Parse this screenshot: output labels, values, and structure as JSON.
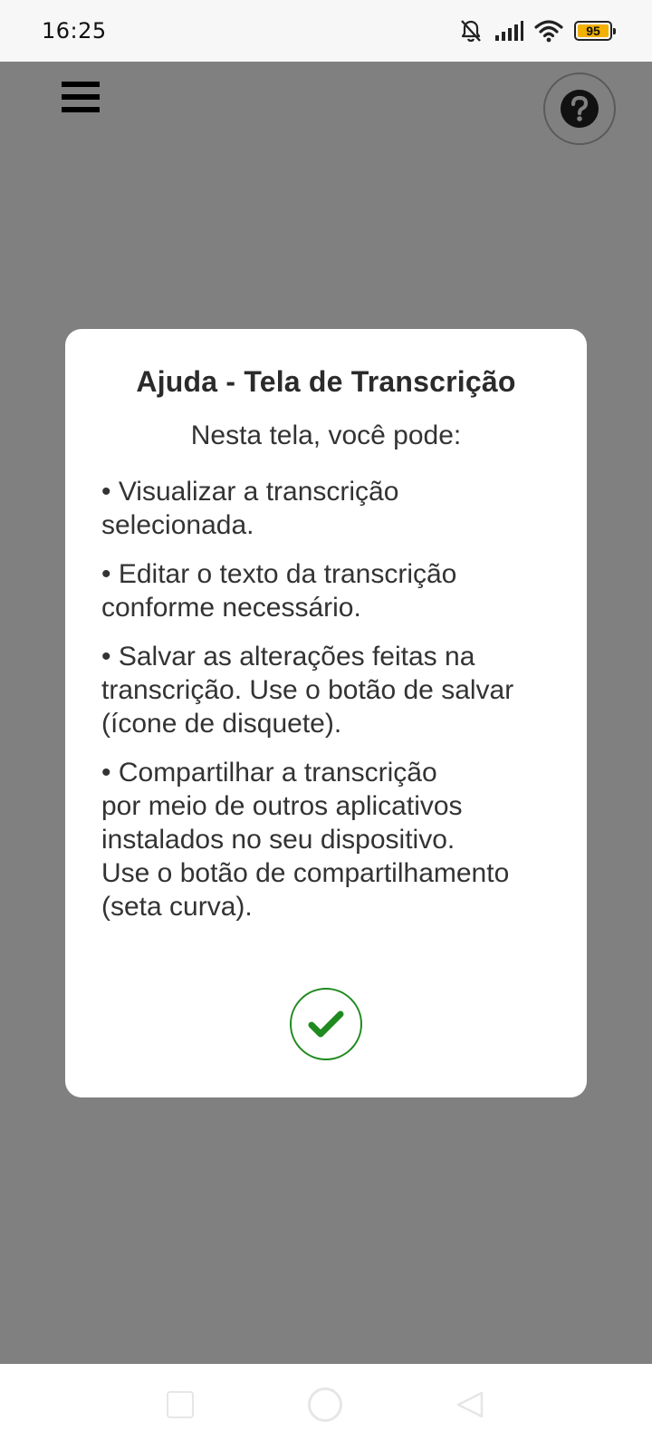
{
  "status_bar": {
    "time": "16:25",
    "icons": [
      "bell-off-icon",
      "signal-icon",
      "wifi-icon",
      "battery-icon"
    ],
    "battery_level": "95",
    "battery_color": "#f2b100"
  },
  "header": {
    "menu_icon": "hamburger-menu-icon",
    "help_icon": "question-circle-icon"
  },
  "dialog": {
    "title": "Ajuda - Tela de Transcrição",
    "intro": "Nesta tela, você pode:",
    "bullets": [
      "• Visualizar a transcrição\nselecionada.",
      "• Editar o texto da transcrição\nconforme necessário.",
      "• Salvar as alterações feitas na\ntranscrição. Use o botão de salvar\n(ícone de disquete).",
      "• Compartilhar a transcrição\npor meio de outros aplicativos\ninstalados no seu dispositivo.\nUse o botão de compartilhamento\n(seta curva)."
    ],
    "confirm_icon": "checkmark-icon",
    "confirm_color": "#1f8a1f"
  },
  "nav_bar": {
    "icons": [
      "recents-icon",
      "home-icon",
      "back-icon"
    ]
  }
}
